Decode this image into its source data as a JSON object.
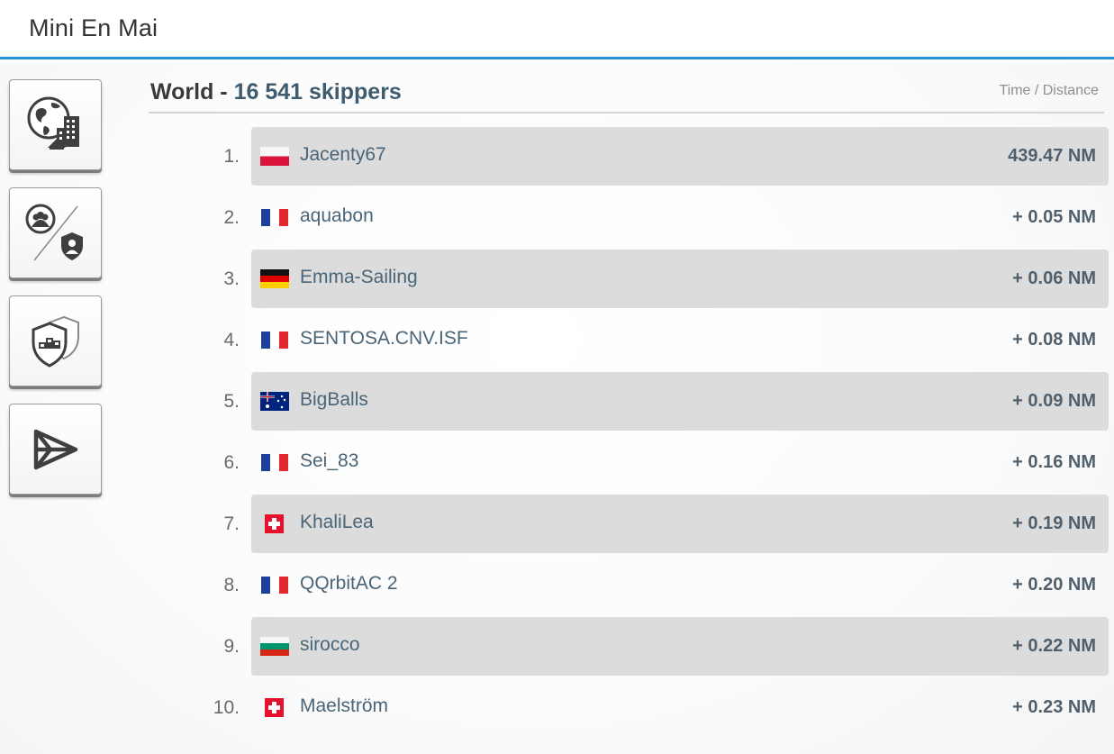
{
  "window": {
    "title": "Mini En Mai"
  },
  "sidebar": {
    "buttons": [
      {
        "name": "world-ranking-button",
        "icon": "globe-city-icon"
      },
      {
        "name": "group-team-ranking-button",
        "icon": "group-shield-split-icon"
      },
      {
        "name": "podium-ranking-button",
        "icon": "shield-podium-icon"
      },
      {
        "name": "race-flag-button",
        "icon": "pennant-flag-icon"
      }
    ]
  },
  "leaderboard": {
    "title_prefix": "World - ",
    "title_count": "16 541 skippers",
    "column_label": "Time / Distance",
    "rows": [
      {
        "rank": "1.",
        "name": "Jacenty67",
        "flag": "poland-flag-icon",
        "value": "439.47 NM"
      },
      {
        "rank": "2.",
        "name": "aquabon",
        "flag": "france-flag-icon",
        "value": "+ 0.05 NM"
      },
      {
        "rank": "3.",
        "name": "Emma-Sailing",
        "flag": "germany-flag-icon",
        "value": "+ 0.06 NM"
      },
      {
        "rank": "4.",
        "name": "SENTOSA.CNV.ISF",
        "flag": "france-flag-icon",
        "value": "+ 0.08 NM"
      },
      {
        "rank": "5.",
        "name": "BigBalls",
        "flag": "australia-flag-icon",
        "value": "+ 0.09 NM"
      },
      {
        "rank": "6.",
        "name": "Sei_83",
        "flag": "france-flag-icon",
        "value": "+ 0.16 NM"
      },
      {
        "rank": "7.",
        "name": "KhaliLea",
        "flag": "switzerland-flag-icon",
        "value": "+ 0.19 NM"
      },
      {
        "rank": "8.",
        "name": "QQrbitAC 2",
        "flag": "france-flag-icon",
        "value": "+ 0.20 NM"
      },
      {
        "rank": "9.",
        "name": "sirocco",
        "flag": "bulgaria-flag-icon",
        "value": "+ 0.22 NM"
      },
      {
        "rank": "10.",
        "name": "Maelström",
        "flag": "switzerland-flag-icon",
        "value": "+ 0.23 NM"
      }
    ]
  },
  "colors": {
    "accent": "#2492d9",
    "row_shade": "#dcdcdc",
    "name_text": "#4a6577",
    "value_text": "#4f5f6b"
  }
}
